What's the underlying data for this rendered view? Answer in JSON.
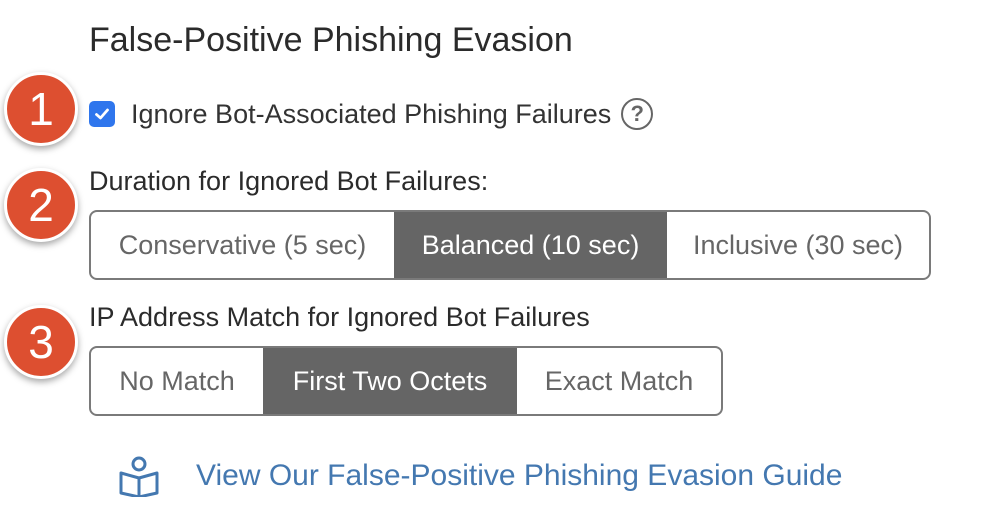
{
  "section": {
    "title": "False-Positive Phishing Evasion"
  },
  "steps": [
    "1",
    "2",
    "3"
  ],
  "ignore_bot": {
    "label": "Ignore Bot-Associated Phishing Failures",
    "checked": true,
    "help_glyph": "?",
    "help_icon": "question-circle-icon"
  },
  "duration": {
    "label": "Duration for Ignored Bot Failures:",
    "options": [
      "Conservative (5 sec)",
      "Balanced (10 sec)",
      "Inclusive (30 sec)"
    ],
    "selected": "Balanced (10 sec)"
  },
  "ip_match": {
    "label": "IP Address Match for Ignored Bot Failures",
    "options": [
      "No Match",
      "First Two Octets",
      "Exact Match"
    ],
    "selected": "First Two Octets"
  },
  "guide": {
    "text": "View Our False-Positive Phishing Evasion Guide",
    "icon": "reading-book-icon"
  },
  "colors": {
    "step_badge": "#dd4f30",
    "checkbox": "#2f76ed",
    "selected_segment": "#656565",
    "link": "#4478b0"
  }
}
